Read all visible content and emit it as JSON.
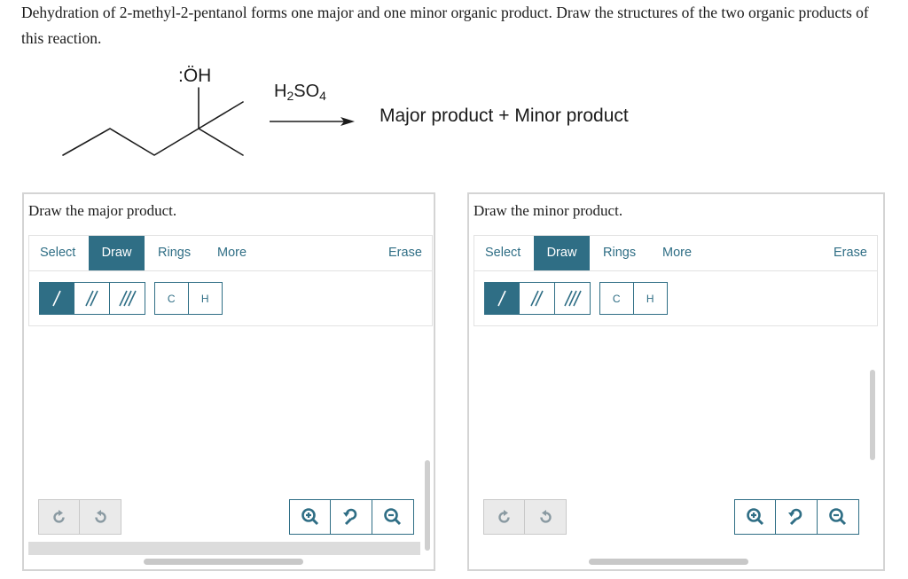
{
  "question": {
    "text": "Dehydration of 2-methyl-2-pentanol forms one major and one minor organic product. Draw the structures of the two organic products of this reaction."
  },
  "scheme": {
    "oh_label": ":ÖH",
    "reagent_h": "H",
    "reagent_h_sub": "2",
    "reagent_so": "SO",
    "reagent_so_sub": "4",
    "products": "Major product + Minor product"
  },
  "panels": [
    {
      "title": "Draw the major product.",
      "tabs": {
        "select": "Select",
        "draw": "Draw",
        "rings": "Rings",
        "more": "More",
        "erase": "Erase"
      },
      "atoms": {
        "c": "C",
        "h": "H"
      }
    },
    {
      "title": "Draw the minor product.",
      "tabs": {
        "select": "Select",
        "draw": "Draw",
        "rings": "Rings",
        "more": "More",
        "erase": "Erase"
      },
      "atoms": {
        "c": "C",
        "h": "H"
      }
    }
  ],
  "icons": {
    "single_bond": "single-bond-icon",
    "double_bond": "double-bond-icon",
    "triple_bond": "triple-bond-icon",
    "undo": "undo-icon",
    "redo": "redo-icon",
    "zoom_in": "zoom-in-icon",
    "zoom_reset": "zoom-reset-icon",
    "zoom_out": "zoom-out-icon"
  },
  "colors": {
    "accent": "#2f6e85",
    "panel_border": "#d4d4d4",
    "disabled": "#eaeaea"
  }
}
